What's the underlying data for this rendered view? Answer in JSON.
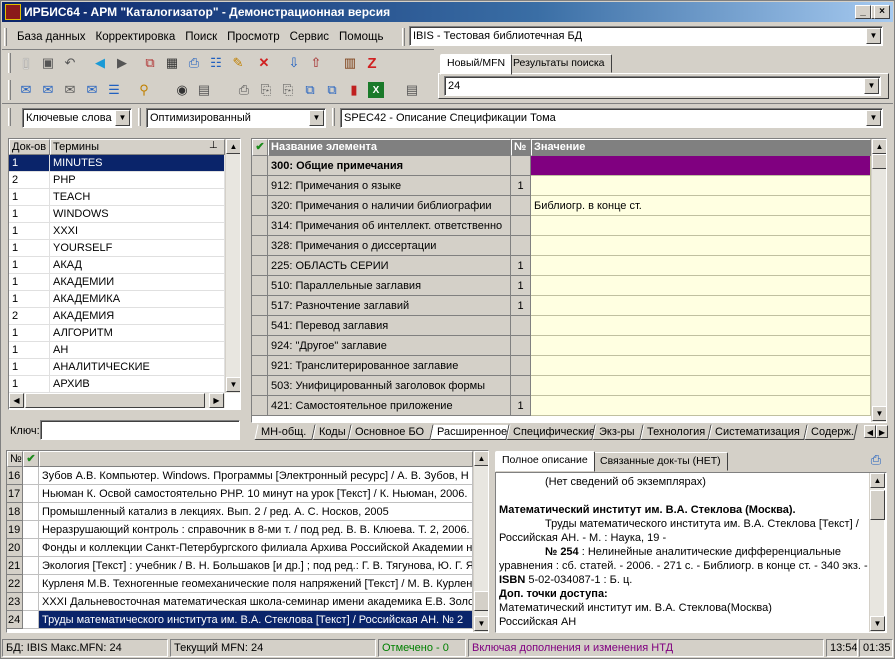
{
  "window": {
    "title": "ИРБИС64 - АРМ \"Каталогизатор\" - Демонстрационная версия"
  },
  "menu": [
    "База данных",
    "Корректировка",
    "Поиск",
    "Просмотр",
    "Сервис",
    "Помощь"
  ],
  "db_selector": {
    "value": "IBIS - Тестовая библиотечная БД"
  },
  "search_tabs": [
    "Новый/MFN",
    "Результаты поиска"
  ],
  "mfn_input": {
    "value": "24"
  },
  "search_mode": {
    "value": "Ключевые слова"
  },
  "optim": {
    "value": "Оптимизированный"
  },
  "worksheet": {
    "value": "SPEC42 - Описание Спецификации Тома"
  },
  "dict": {
    "headers": [
      "Док-ов",
      "Термины"
    ],
    "rows": [
      {
        "count": "1",
        "term": "MINUTES"
      },
      {
        "count": "2",
        "term": "PHP"
      },
      {
        "count": "1",
        "term": "TEACH"
      },
      {
        "count": "1",
        "term": "WINDOWS"
      },
      {
        "count": "1",
        "term": "XXXI"
      },
      {
        "count": "1",
        "term": "YOURSELF"
      },
      {
        "count": "1",
        "term": "АКАД"
      },
      {
        "count": "1",
        "term": "АКАДЕМИИ"
      },
      {
        "count": "1",
        "term": "АКАДЕМИКА"
      },
      {
        "count": "2",
        "term": "АКАДЕМИЯ"
      },
      {
        "count": "1",
        "term": "АЛГОРИТМ"
      },
      {
        "count": "1",
        "term": "АН"
      },
      {
        "count": "1",
        "term": "АНАЛИТИЧЕСКИЕ"
      },
      {
        "count": "1",
        "term": "АРХИВ"
      }
    ],
    "key_label": "Ключ:"
  },
  "fields": {
    "headers": [
      "Название элемента",
      "№",
      "Значение"
    ],
    "rows": [
      {
        "name": "300: Общие примечания",
        "num": "",
        "value": ""
      },
      {
        "name": "912: Примечания о языке",
        "num": "1",
        "value": ""
      },
      {
        "name": "320: Примечания о наличии библиографии",
        "num": "",
        "value": "Библиогр. в конце ст."
      },
      {
        "name": "314: Примечания об интеллект. ответственно",
        "num": "",
        "value": ""
      },
      {
        "name": "328: Примечания о диссертации",
        "num": "",
        "value": ""
      },
      {
        "name": "225: ОБЛАСТЬ СЕРИИ",
        "num": "1",
        "value": ""
      },
      {
        "name": "510: Параллельные заглавия",
        "num": "1",
        "value": ""
      },
      {
        "name": "517: Разночтение заглавий",
        "num": "1",
        "value": ""
      },
      {
        "name": "541: Перевод заглавия",
        "num": "",
        "value": ""
      },
      {
        "name": "924: \"Другое\" заглавие",
        "num": "",
        "value": ""
      },
      {
        "name": "921: Транслитерированное заглавие",
        "num": "",
        "value": ""
      },
      {
        "name": "503: Унифицированный заголовок формы",
        "num": "",
        "value": ""
      },
      {
        "name": "421: Самостоятельное приложение",
        "num": "1",
        "value": ""
      }
    ]
  },
  "bottom_tabs": [
    "МН-общ.",
    "Коды",
    "Основное БО",
    "Расширенное",
    "Специфические",
    "Экз-ры",
    "Технология",
    "Систематизация",
    "Содерж."
  ],
  "records": {
    "header_num": "№",
    "rows": [
      {
        "n": "16",
        "text": "Зубов А.В. Компьютер. Windows. Программы [Электронный ресурс] / А. В. Зубов, Н"
      },
      {
        "n": "17",
        "text": "Ньюман К. Освой самостоятельно PHP. 10 минут на урок [Текст] / К. Ньюман, 2006."
      },
      {
        "n": "18",
        "text": "Промышленный катализ в лекциях. Вып. 2 / ред. А. С. Носков, 2005"
      },
      {
        "n": "19",
        "text": "Неразрушающий контроль : справочник в 8-ми т. / под ред. В. В. Клюева. Т. 2, 2006."
      },
      {
        "n": "20",
        "text": "Фонды и коллекции Санкт-Петербургского филиала Архива Российской Академии н"
      },
      {
        "n": "21",
        "text": "Экология [Текст] : учебник / В. Н. Большаков [и др.] ; под ред.: Г. В. Тягунова, Ю. Г. Я"
      },
      {
        "n": "22",
        "text": "Курленя М.В. Техногенные геомеханические поля напряжений [Текст] / М. В. Курлен"
      },
      {
        "n": "23",
        "text": "XXXI Дальневосточная математическая школа-семинар имени академика Е.В. Золо"
      },
      {
        "n": "24",
        "text": "Труды математического института им. В.А. Стеклова [Текст] / Российская АН. № 2"
      }
    ]
  },
  "desc_tabs": [
    "Полное описание",
    "Связанные док-ты (НЕТ)"
  ],
  "description": {
    "line1": "(Нет сведений об экземплярах)",
    "heading": "Математический институт им. В.А. Стеклова (Москва).",
    "p1": "Труды математического института им. В.А. Стеклова [Текст] / Российская АН. - М. : Наука, 19 -",
    "p2_num": "№ 254",
    "p2": " : Нелинейные аналитические дифференциальные уравнения : сб. статей. - 2006. - 271 с. - Библиогр. в конце ст. - 340 экз. -",
    "isbn": "ISBN",
    "isbn_val": " 5-02-034087-1 : Б. ц.",
    "access_label": "Доп. точки доступа:",
    "access1": "Математический институт им. В.А. Стеклова(Москва)",
    "access2": "Российская АН"
  },
  "status": {
    "db": "БД: IBIS Макс.MFN: 24",
    "current": "Текущий MFN: 24",
    "marked": "Отмечено - 0",
    "ntd": "Включая дополнения и изменения НТД",
    "time1": "13:54",
    "time2": "01:35"
  },
  "colors": {
    "selection": "#0a246a",
    "purple_row": "#800080",
    "value_col": "#ffffe1",
    "marked": "#008000",
    "ntd": "#800080"
  }
}
